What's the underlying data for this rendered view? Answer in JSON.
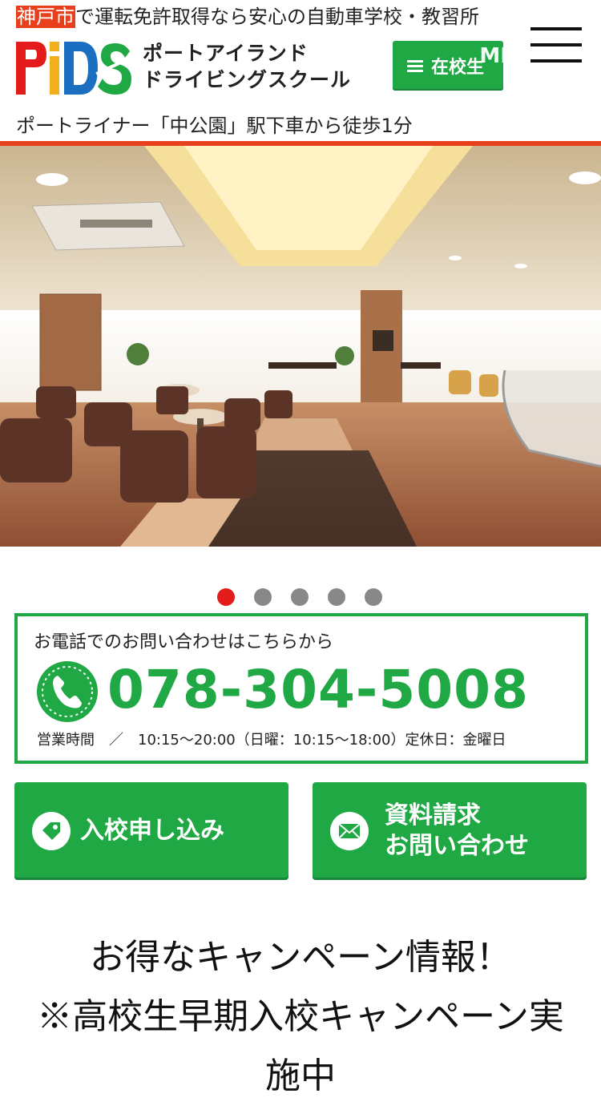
{
  "header": {
    "tagline_highlight": "神戸市",
    "tagline_rest": "で運転免許取得なら安心の自動車学校・教習所",
    "logo_mark": "PiDS",
    "logo_line1": "ポートアイランド",
    "logo_line2": "ドライビングスクール",
    "student_button_label": "在校生",
    "student_button_overlay": "ME",
    "access": "ポートライナー「中公園」駅下車から徒歩1分"
  },
  "slider": {
    "dots": [
      {
        "active": true
      },
      {
        "active": false
      },
      {
        "active": false
      },
      {
        "active": false
      },
      {
        "active": false
      }
    ]
  },
  "contact": {
    "heading": "お電話でのお問い合わせはこちらから",
    "phone": "078-304-5008",
    "hours": "営業時間　／　10:15〜20:00（日曜：10:15〜18:00）定休日：金曜日"
  },
  "cta": {
    "apply_label": "入校申し込み",
    "docs_line1": "資料請求",
    "docs_line2": "お問い合わせ"
  },
  "campaign": {
    "line1": "お得なキャンペーン情報！",
    "line2": "※高校生早期入校キャンペーン実",
    "line3": "施中"
  },
  "colors": {
    "accent_green": "#1fa843",
    "accent_red": "#e8401c",
    "logo_red": "#e41b1b",
    "logo_blue": "#1a6fc1"
  }
}
